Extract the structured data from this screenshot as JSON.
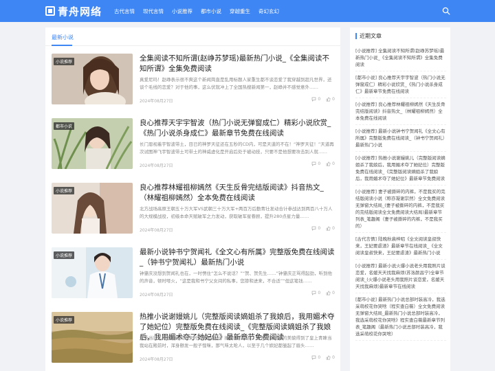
{
  "header": {
    "logo_text": "青舟网络",
    "nav": [
      "古代言情",
      "现代言情",
      "小说推荐",
      "都市小说",
      "穿越重生",
      "奇幻玄幻"
    ],
    "accent": "#3f86f5"
  },
  "main": {
    "title": "最新小说",
    "articles": [
      {
        "tag": "小说推荐",
        "title": "全集阅读不知所谓(赵峥苏梦瑶)最新热门小说_《全集阅读不知所谓》全集免费阅读",
        "excerpt": "真爱尼玛！赵峥表示很不爽这个新闻简直是乱用标题人家重生都不谈恋爱了我穿越到超凡世界，还谈个毛线的恋爱？对于他的事，这么伏就冲上了全国热搜新闻第一，赵峥并不感觉意外……",
        "date": "2024年08月27日",
        "comments": "0",
        "likes": "0"
      },
      {
        "tag": "都市小说",
        "title": "良心推荐天宇宇智波（热门小说无弹窗成仁）精彩小说欣赏_《热门小说杀身成仁》最新章节免费在线阅读",
        "excerpt": "长门恩视着宇智波带土，目已的神罗天征还在五秒的CD内，可是天道的不在！“神罗天征！”天道再次试图神飞宇智波带土可带土的神威虚化是开启后处于被动技，只要不是他想要攻击别人就……",
        "date": "2024年08月27日",
        "comments": "0",
        "likes": "0"
      },
      {
        "tag": "小说推荐",
        "title": "良心推荐林耀祖柳嫣然《天生反骨完结版阅读》抖音热文_（林耀祖柳嫣然）全本免费在线阅读",
        "excerpt": "北方战场高原王朝五十万大军VS武朝三十万大军+两百万后勤青壮发动合计参战达到两百八十万人的大规模战役，初级本命天赋破军之力发动，获取破军星眷顾，提升280点星力量……",
        "date": "2024年08月27日",
        "comments": "0",
        "likes": "0"
      },
      {
        "tag": "小说推荐",
        "title": "最新小说钟书宁贺闻礼《全文心有所属》完整版免费在线阅读_（钟书宁贺闻礼）最新热门小说",
        "excerpt": "钟肇庆没想到贺闻礼也在，一时愣住“怎么不说话？”“贺、贺先生……”钟肇庆正骂得起劲，听到他的声音，顿时哑火，“这是我和书宁父女间的私事，您掺和进来，不合适”“但这笔钱……",
        "date": "2024年08月27日",
        "comments": "0",
        "likes": "0"
      },
      {
        "tag": "小说推荐",
        "title": "热推小说谢嫚姚儿（完整版阅读嫡姐杀了我娘后，我用媚术夺了她妃位）完整版免费在线阅读_《完整版阅读嫡姐杀了我娘后，我用媚术夺了她妃位》最新章节免费阅读",
        "excerpt": "选秀当日，嫡姐从殿内出来时，满面春光，掩不住的兴奋，毫无疑问地她的美貌得到了皇上青睐当我站在殿前时，浑身颤发一般子惶咪，那气味太呛人，以至于几个嫔妃都皱起了眉头……",
        "date": "2024年08月27日",
        "comments": "0",
        "likes": "0"
      }
    ]
  },
  "sidebar": {
    "title": "近期文章",
    "items": [
      "[小说推荐] 全集阅读不知所谓(赵峥苏梦瑶)最新热门小说_《全集阅读不知所谓》全集免费阅读",
      "[都市小说] 良心推荐天宇宇智波（热门小说无弹窗成仁）精彩小说欣赏_《热门小说杀身成仁》最新章节免费在线阅读",
      "[小说推荐] 良心推荐林耀祖柳嫣然《天生反骨完结版阅读》抖音热文_（林耀祖柳嫣然）全本免费在线阅读",
      "[小说推荐] 最新小说钟书宁贺闻礼《全文心有所属》完整版免费在线阅读_（钟书宁贺闻礼）最新热门小说",
      "[小说推荐] 热推小说谢嫚姚儿（完整版阅读嫡姐杀了我娘后，我用媚术夺了她妃位）完整版免费在线阅读_《完整版阅读嫡姐杀了我娘后，我用媚术夺了她妃位》最新章节免费阅读",
      "[小说推荐] 妻子被撕碎的内裤，不是我买的完结版阅读小说（称亦凝谢宗然）全文免费阅读无弹窗大结局_(妻子被撕碎的内裤，不是我买的完结版阅读全文免费阅读大结局)最新章节列表_笔趣阁（妻子被撕碎的内裤，不是我买的）",
      "[古代言情] 陆晚秋裴梓昭《全文阅读皇叔快来，王妃要虐渣》最新章节在线阅读_《全文阅读皇叔快来，王妃要虐渣》最新热门小说",
      "[小说推荐] 最新小说火爆小说老头用我照片谈恋爱，名媛天天找我麻烦(苏洛颜昌宁)全章节阅读_(火爆小说老头用我照片谈恋爱，名媛天天找我麻烦)最新章节在线阅读",
      "[都市小说] 最新热门小说总部时装高冷，我选采萌校花你哭啥（程实查白薇）全文免费阅读无弹窗大结局_最新热门小说总部时装高冷，我选采萌校花你哭啥》程实查白薇最新章节列表_笔趣阁（最新热门小说总部时装高冷，我选采萌校花你哭啥）"
    ]
  }
}
